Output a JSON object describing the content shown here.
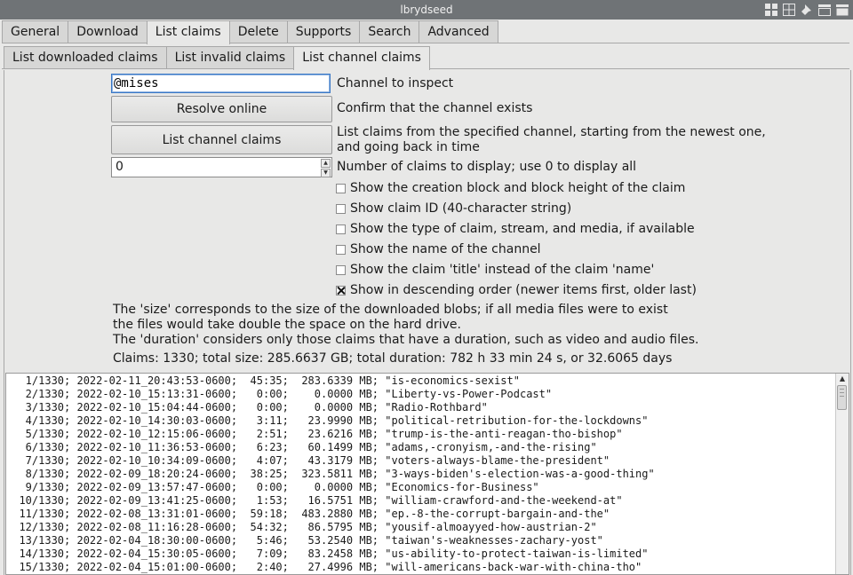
{
  "window": {
    "title": "lbrydseed"
  },
  "tabs_main": [
    "General",
    "Download",
    "List claims",
    "Delete",
    "Supports",
    "Search",
    "Advanced"
  ],
  "tabs_sub": [
    "List downloaded claims",
    "List invalid claims",
    "List channel claims"
  ],
  "form": {
    "channel_value": "@mises",
    "channel_desc": "Channel to inspect",
    "resolve_label": "Resolve online",
    "resolve_desc": "Confirm that the channel exists",
    "list_label": "List channel claims",
    "list_desc_1": "List claims from the specified channel, starting from the newest one,",
    "list_desc_2": "and going back in time",
    "number_value": "0",
    "number_desc": "Number of claims to display; use 0 to display all"
  },
  "checkboxes": [
    {
      "label": "Show the creation block and block height of the claim",
      "checked": false
    },
    {
      "label": "Show claim ID (40-character string)",
      "checked": false
    },
    {
      "label": "Show the type of claim, stream, and media, if available",
      "checked": false
    },
    {
      "label": "Show the name of the channel",
      "checked": false
    },
    {
      "label": "Show the claim 'title' instead of the claim 'name'",
      "checked": false
    },
    {
      "label": "Show in descending order (newer items first, older last)",
      "checked": true
    }
  ],
  "notes": {
    "line1": "The 'size' corresponds to the size of the downloaded blobs; if all media files were to exist",
    "line2": "the files would take double the space on the hard drive.",
    "line3": "The 'duration' considers only those claims that have a duration, such as video and audio files.",
    "summary": "Claims: 1330; total size: 285.6637 GB; total duration: 782 h 33 min 24 s, or 32.6065 days"
  },
  "output_lines": [
    "   1/1330; 2022-02-11_20:43:53-0600;  45:35;  283.6339 MB; \"is-economics-sexist\"",
    "   2/1330; 2022-02-10_15:13:31-0600;   0:00;    0.0000 MB; \"Liberty-vs-Power-Podcast\"",
    "   3/1330; 2022-02-10_15:04:44-0600;   0:00;    0.0000 MB; \"Radio-Rothbard\"",
    "   4/1330; 2022-02-10_14:30:03-0600;   3:11;   23.9990 MB; \"political-retribution-for-the-lockdowns\"",
    "   5/1330; 2022-02-10_12:15:06-0600;   2:51;   23.6216 MB; \"trump-is-the-anti-reagan-tho-bishop\"",
    "   6/1330; 2022-02-10_11:36:53-0600;   6:23;   60.1499 MB; \"adams,-cronyism,-and-the-rising\"",
    "   7/1330; 2022-02-10_10:34:09-0600;   4:07;   43.3179 MB; \"voters-always-blame-the-president\"",
    "   8/1330; 2022-02-09_18:20:24-0600;  38:25;  323.5811 MB; \"3-ways-biden's-election-was-a-good-thing\"",
    "   9/1330; 2022-02-09_13:57:47-0600;   0:00;    0.0000 MB; \"Economics-for-Business\"",
    "  10/1330; 2022-02-09_13:41:25-0600;   1:53;   16.5751 MB; \"william-crawford-and-the-weekend-at\"",
    "  11/1330; 2022-02-08_13:31:01-0600;  59:18;  483.2880 MB; \"ep.-8-the-corrupt-bargain-and-the\"",
    "  12/1330; 2022-02-08_11:16:28-0600;  54:32;   86.5795 MB; \"yousif-almoayyed-how-austrian-2\"",
    "  13/1330; 2022-02-04_18:30:00-0600;   5:46;   53.2540 MB; \"taiwan's-weaknesses-zachary-yost\"",
    "  14/1330; 2022-02-04_15:30:05-0600;   7:09;   83.2458 MB; \"us-ability-to-protect-taiwan-is-limited\"",
    "  15/1330; 2022-02-04_15:01:00-0600;   2:40;   27.4996 MB; \"will-americans-back-war-with-china-tho\""
  ]
}
